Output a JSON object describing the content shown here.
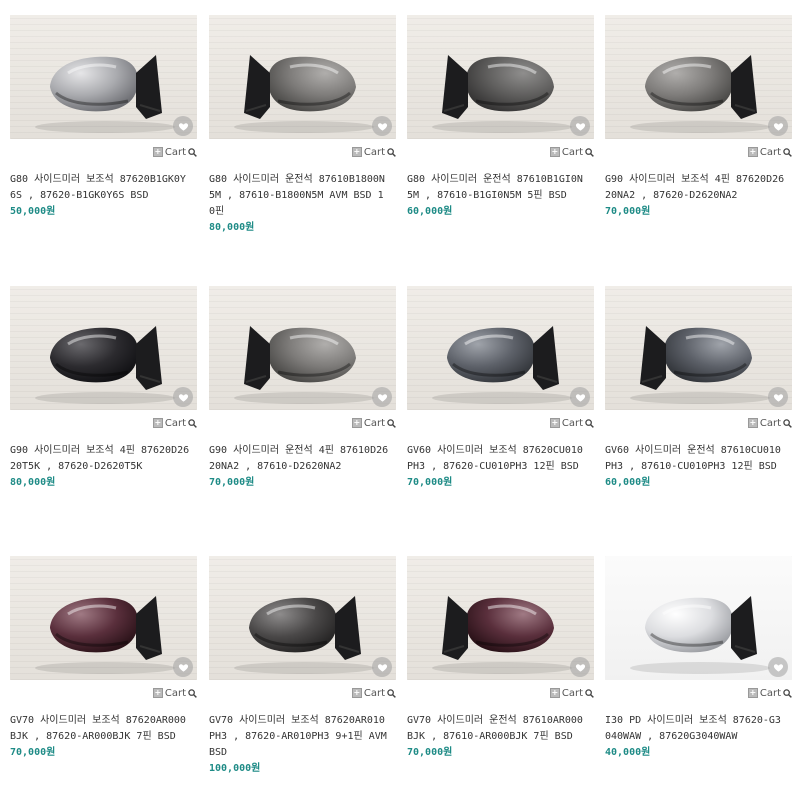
{
  "cart_label": "Cart",
  "colors": {
    "price": "#1e8b86",
    "heart_bg": "#a0a0a0"
  },
  "products": [
    {
      "title": "G80 사이드미러 보조석 87620B1GK0Y6S , 87620-B1GK0Y6S BSD",
      "price": "50,000원",
      "mirror_color": "silver",
      "side": "right"
    },
    {
      "title": "G80 사이드미러 운전석 87610B1800N5M , 87610-B1800N5M AVM BSD 10핀",
      "price": "80,000원",
      "mirror_color": "gray",
      "side": "left"
    },
    {
      "title": "G80 사이드미러 운전석 87610B1GI0N5M , 87610-B1GI0N5M 5핀 BSD",
      "price": "60,000원",
      "mirror_color": "dark-gray",
      "side": "left"
    },
    {
      "title": "G90 사이드미러 보조석 4핀 87620D2620NA2 , 87620-D2620NA2",
      "price": "70,000원",
      "mirror_color": "gray",
      "side": "right"
    },
    {
      "title": "G90 사이드미러 보조석 4핀 87620D2620T5K , 87620-D2620T5K",
      "price": "80,000원",
      "mirror_color": "black",
      "side": "right"
    },
    {
      "title": "G90 사이드미러 운전석 4핀 87610D2620NA2 , 87610-D2620NA2",
      "price": "70,000원",
      "mirror_color": "gray",
      "side": "left"
    },
    {
      "title": "GV60 사이드미러 보조석 87620CU010PH3 , 87620-CU010PH3 12핀 BSD",
      "price": "70,000원",
      "mirror_color": "slate",
      "side": "right"
    },
    {
      "title": "GV60 사이드미러 운전석 87610CU010PH3 , 87610-CU010PH3 12핀 BSD",
      "price": "60,000원",
      "mirror_color": "slate",
      "side": "left"
    },
    {
      "title": "GV70 사이드미러 보조석 87620AR000BJK , 87620-AR000BJK 7핀 BSD",
      "price": "70,000원",
      "mirror_color": "burgundy",
      "side": "right"
    },
    {
      "title": "GV70 사이드미러 보조석 87620AR010PH3 , 87620-AR010PH3 9+1핀 AVM BSD",
      "price": "100,000원",
      "mirror_color": "charcoal",
      "side": "right"
    },
    {
      "title": "GV70 사이드미러 운전석 87610AR000BJK , 87610-AR000BJK 7핀 BSD",
      "price": "70,000원",
      "mirror_color": "burgundy",
      "side": "left"
    },
    {
      "title": "I30 PD 사이드미러 보조석 87620-G3040WAW , 87620G3040WAW",
      "price": "40,000원",
      "mirror_color": "white",
      "side": "right"
    }
  ]
}
